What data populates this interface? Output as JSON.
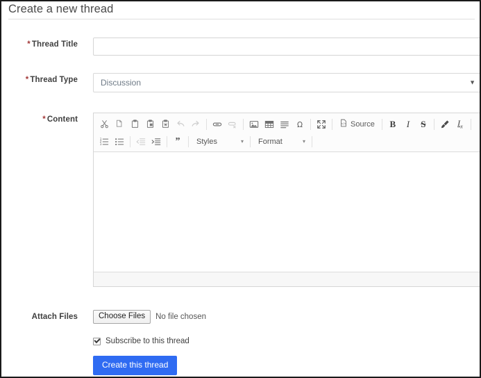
{
  "header": {
    "title": "Create a new thread"
  },
  "form": {
    "required_marker": "*",
    "thread_title": {
      "label": "Thread Title",
      "value": "",
      "placeholder": ""
    },
    "thread_type": {
      "label": "Thread Type",
      "selected": "Discussion",
      "caret": "▼",
      "options": [
        "Discussion"
      ]
    },
    "content": {
      "label": "Content",
      "value": ""
    },
    "attach_files": {
      "label": "Attach Files",
      "button_label": "Choose Files",
      "status_text": "No file chosen"
    },
    "subscribe": {
      "label": "Subscribe to this thread",
      "checked": true
    },
    "submit": {
      "label": "Create this thread"
    }
  },
  "editor": {
    "toolbar_row1": [
      {
        "name": "cut-icon",
        "title": "Cut",
        "disabled": false
      },
      {
        "name": "copy-icon",
        "title": "Copy",
        "disabled": false
      },
      {
        "name": "paste-icon",
        "title": "Paste",
        "disabled": false
      },
      {
        "name": "paste-text-icon",
        "title": "Paste as plain text",
        "disabled": false
      },
      {
        "name": "paste-word-icon",
        "title": "Paste from Word",
        "disabled": false
      },
      {
        "name": "undo-icon",
        "title": "Undo",
        "disabled": true
      },
      {
        "name": "redo-icon",
        "title": "Redo",
        "disabled": true
      },
      {
        "name": "link-icon",
        "title": "Link",
        "disabled": false
      },
      {
        "name": "unlink-icon",
        "title": "Unlink",
        "disabled": true
      },
      {
        "name": "image-icon",
        "title": "Image",
        "disabled": false
      },
      {
        "name": "table-icon",
        "title": "Table",
        "disabled": false
      },
      {
        "name": "horizontal-rule-icon",
        "title": "Horizontal Line",
        "disabled": false
      },
      {
        "name": "special-char-icon",
        "title": "Insert Special Character",
        "disabled": false
      },
      {
        "name": "maximize-icon",
        "title": "Maximize",
        "disabled": false
      }
    ],
    "source_button": {
      "label": "Source",
      "icon": "source-icon"
    },
    "format_buttons": [
      {
        "name": "bold-icon",
        "label": "B"
      },
      {
        "name": "italic-icon",
        "label": "I"
      },
      {
        "name": "strikethrough-icon",
        "label": "S"
      },
      {
        "name": "remove-format-icon",
        "label": ""
      },
      {
        "name": "subscript-remove-icon",
        "label": "Ix"
      }
    ],
    "toolbar_row2": [
      {
        "name": "numbered-list-icon",
        "title": "Insert/Remove Numbered List",
        "disabled": false
      },
      {
        "name": "bulleted-list-icon",
        "title": "Insert/Remove Bulleted List",
        "disabled": false
      },
      {
        "name": "decrease-indent-icon",
        "title": "Decrease Indent",
        "disabled": true
      },
      {
        "name": "increase-indent-icon",
        "title": "Increase Indent",
        "disabled": false
      },
      {
        "name": "blockquote-icon",
        "title": "Block Quote",
        "disabled": false
      }
    ],
    "styles_combo": {
      "label": "Styles",
      "caret": "▼"
    },
    "format_combo": {
      "label": "Format",
      "caret": "▼"
    },
    "content_text": ""
  },
  "colors": {
    "accent": "#2f6bf2",
    "required": "#a33a3a",
    "label": "#3f3f3f",
    "border": "#d6d6d6",
    "toolbar_bg": "#fcfcfc",
    "footer_bg": "#f7f7f7"
  }
}
